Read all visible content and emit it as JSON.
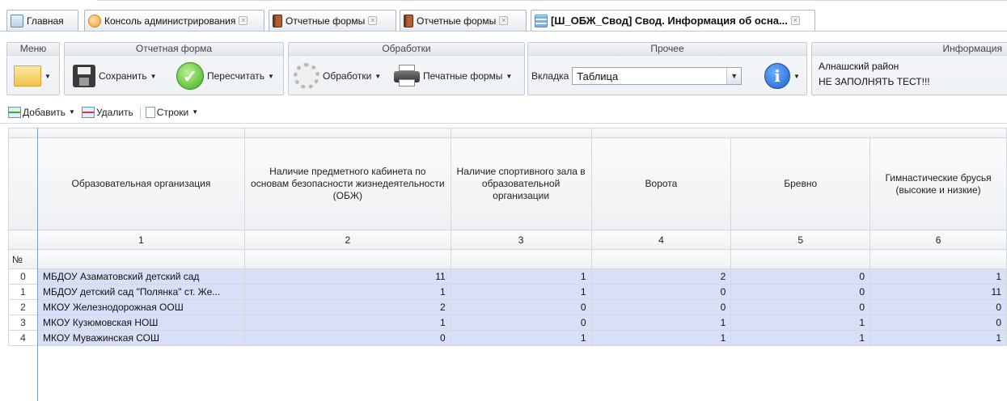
{
  "tabs": [
    {
      "label": "Главная",
      "icon": "home-icon"
    },
    {
      "label": "Консоль администрирования",
      "icon": "console-icon"
    },
    {
      "label": "Отчетные формы",
      "icon": "book-icon"
    },
    {
      "label": "Отчетные формы",
      "icon": "book-icon"
    },
    {
      "label": "[Ш_ОБЖ_Свод] Свод. Информация об осна...",
      "icon": "grid-icon"
    }
  ],
  "tab_close_glyph": "×",
  "ribbon": {
    "menu": {
      "title": "Меню"
    },
    "report_form": {
      "title": "Отчетная форма",
      "save_label": "Сохранить",
      "recalc_label": "Пересчитать"
    },
    "processing": {
      "title": "Обработки",
      "processing_label": "Обработки",
      "print_label": "Печатные формы"
    },
    "other": {
      "title": "Прочее",
      "tab_label": "Вкладка",
      "tab_value": "Таблица"
    },
    "info": {
      "title": "Информация",
      "line1": "Алнашский район",
      "line2": "НЕ ЗАПОЛНЯТЬ ТЕСТ!!!"
    }
  },
  "toolbar": {
    "add_label": "Добавить",
    "delete_label": "Удалить",
    "rows_label": "Строки"
  },
  "table": {
    "headers": [
      "Образовательная организация",
      "Наличие предметного кабинета по основам безопасности жизнедеятельности (ОБЖ)",
      "Наличие спортивного зала в образовательной организации",
      "Ворота",
      "Бревно",
      "Гимнастические брусья (высокие и низкие)"
    ],
    "col_numbers": [
      "1",
      "2",
      "3",
      "4",
      "5",
      "6"
    ],
    "no_label": "№",
    "rows": [
      {
        "n": "0",
        "org": "МБДОУ Азаматовский детский сад",
        "c2": "11",
        "c3": "1",
        "c4": "2",
        "c5": "0",
        "c6": "1"
      },
      {
        "n": "1",
        "org": "МБДОУ детский сад \"Полянка\" ст. Же...",
        "c2": "1",
        "c3": "1",
        "c4": "0",
        "c5": "0",
        "c6": "11"
      },
      {
        "n": "2",
        "org": "МКОУ Железнодорожная ООШ",
        "c2": "2",
        "c3": "0",
        "c4": "0",
        "c5": "0",
        "c6": "0"
      },
      {
        "n": "3",
        "org": "МКОУ Кузюмовская НОШ",
        "c2": "1",
        "c3": "0",
        "c4": "1",
        "c5": "1",
        "c6": "0"
      },
      {
        "n": "4",
        "org": "МКОУ Муважинская СОШ",
        "c2": "0",
        "c3": "1",
        "c4": "1",
        "c5": "1",
        "c6": "1"
      }
    ]
  }
}
